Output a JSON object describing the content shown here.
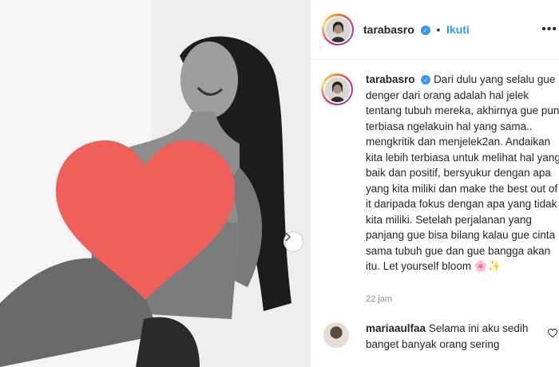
{
  "post": {
    "username": "tarabasro",
    "follow_label": "Ikuti",
    "separator": "•",
    "caption": "Dari dulu yang selalu gue denger dari orang adalah hal jelek tentang tubuh mereka, akhirnya gue pun terbiasa ngelakuin hal yang sama.. mengkritik dan menjelek2an. Andaikan kita lebih terbiasa untuk melihat hal yang baik dan positif, bersyukur dengan apa yang kita miliki dan make the best out of it daripada fokus dengan apa yang tidak kita miliki. Setelah perjalanan yang panjang gue bisa bilang kalau gue cinta sama tubuh gue dan gue bangga akan itu. Let yourself bloom 🌸✨",
    "time": "22 jam"
  },
  "comment": {
    "username": "mariaaulfaa",
    "text": "Selama ini aku sedih banget banyak orang sering"
  },
  "colors": {
    "accent": "#3897f0",
    "censor_heart": "#f0605a"
  },
  "icons": {
    "verified": "verified-badge-icon",
    "more": "more-options-icon",
    "next": "chevron-right-icon",
    "like": "heart-outline-icon"
  }
}
